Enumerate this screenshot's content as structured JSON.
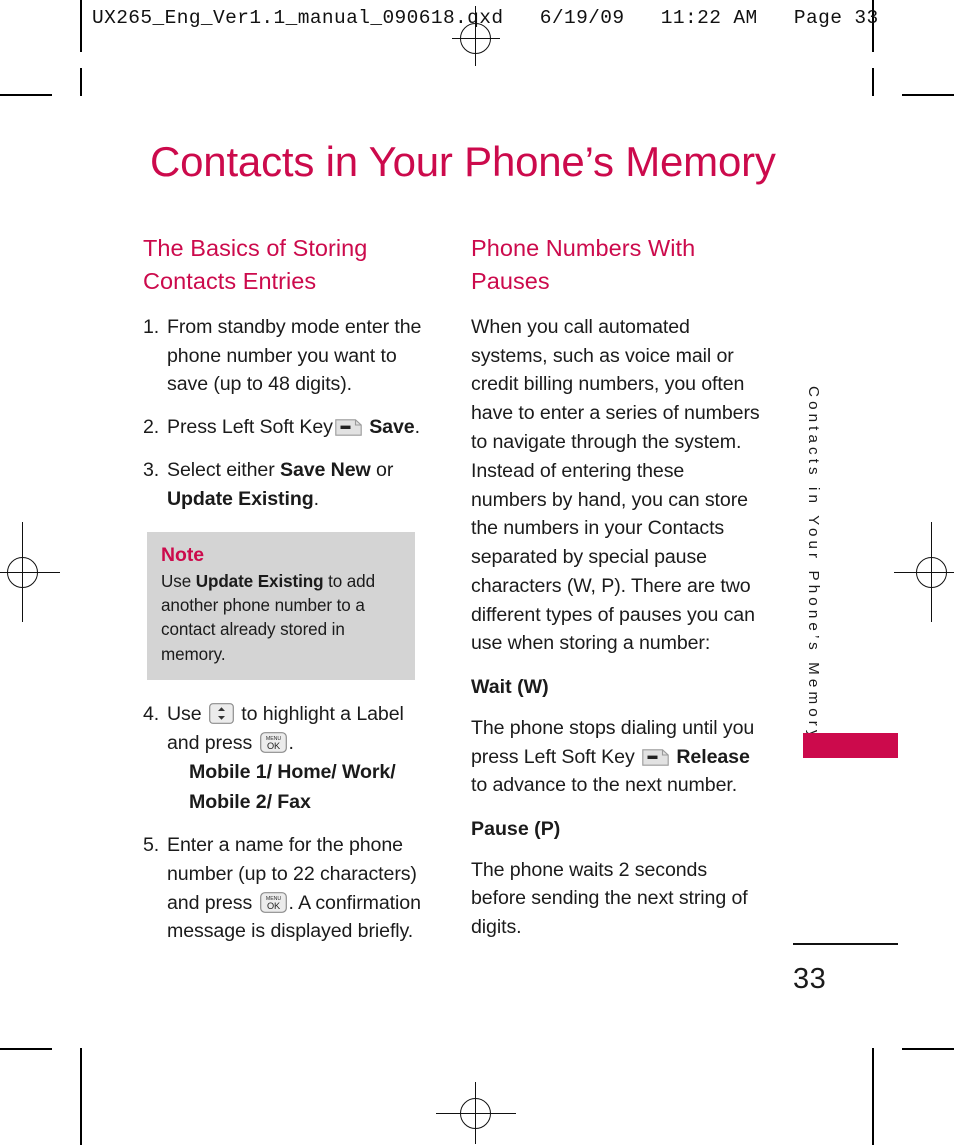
{
  "preflight": {
    "text": "UX265_Eng_Ver1.1_manual_090618.qxd   6/19/09   11:22 AM   Page 33"
  },
  "page": {
    "title": "Contacts in Your Phone’s Memory",
    "number": "33",
    "side_tab_text": "Contacts in Your Phone’s Memory",
    "accent_color": "#cc0a4c",
    "note_bg_color": "#d4d4d4",
    "text_color": "#1b1b1b"
  },
  "left_column": {
    "heading": "The Basics of Storing Contacts Entries",
    "steps": [
      {
        "num": "1.",
        "pre": "From standby mode enter the phone number you want to save (up to 48 digits).",
        "icon": null,
        "post": "",
        "bold_mid": "",
        "sub": ""
      },
      {
        "num": "2.",
        "pre": "Press Left Soft Key",
        "icon": "left-soft-key",
        "bold_mid": "Save",
        "post": ".",
        "sub": ""
      },
      {
        "num": "3.",
        "pre": "Select either ",
        "bold_a": "Save New",
        "mid": " or ",
        "bold_b": "Update Existing",
        "post": ".",
        "sub": ""
      },
      {
        "num": "4.",
        "pre": "Use",
        "icon": "navigation-key",
        "mid": "to highlight a Label and press",
        "icon2": "menu-ok-key",
        "post": ".",
        "sub_line_1": "Mobile 1/ Home/ Work/",
        "sub_line_2": "Mobile 2/ Fax"
      },
      {
        "num": "5.",
        "pre": "Enter a name for the phone number (up to 22 characters) and press",
        "icon": "menu-ok-key",
        "post": ". A confirmation message is displayed briefly.",
        "sub": ""
      }
    ],
    "note": {
      "title": "Note",
      "pre": "Use ",
      "bold": "Update Existing",
      "post": " to add another phone number to a contact already stored in memory."
    }
  },
  "right_column": {
    "heading": "Phone Numbers With Pauses",
    "intro": "When you call automated systems, such as voice mail or credit billing numbers, you often have to enter a series of numbers to navigate through the system. Instead of entering these numbers by hand, you can store the numbers in your Contacts separated by special pause characters (W, P). There are two different types of pauses you can use when storing a number:",
    "sections": [
      {
        "title": "Wait (W)",
        "pre": "The phone stops dialing until you press Left Soft Key",
        "icon": "left-soft-key",
        "bold": "Release",
        "post": " to advance to the next number."
      },
      {
        "title": "Pause (P)",
        "pre": "The phone waits 2 seconds before sending the next string of digits.",
        "icon": null,
        "bold": "",
        "post": ""
      }
    ]
  },
  "icons": {
    "left_soft_key": "left-soft-key-icon",
    "navigation_key": "navigation-key-icon",
    "menu_ok_key": "menu-ok-key-icon",
    "menu_label": "MENU",
    "ok_label": "OK"
  }
}
